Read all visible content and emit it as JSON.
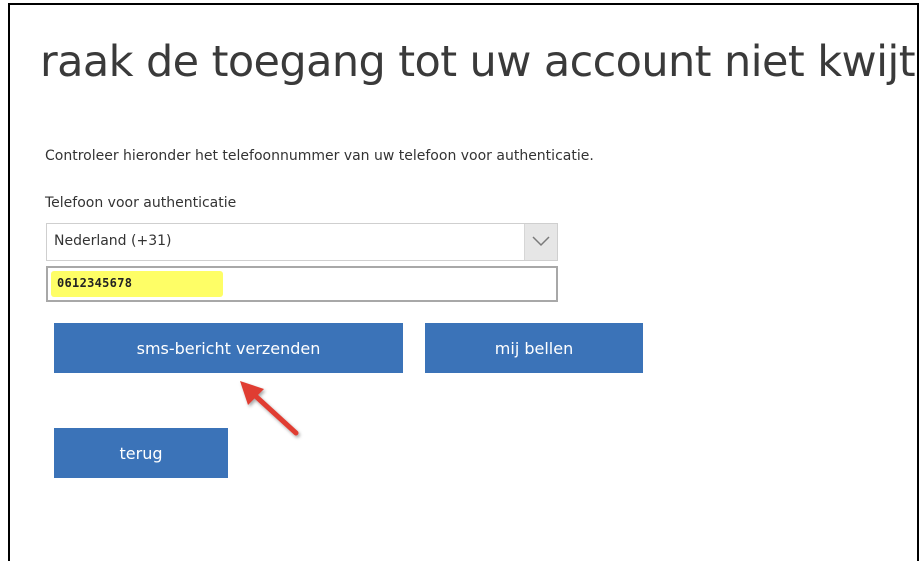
{
  "page": {
    "title": "raak de toegang tot uw account niet kwijt",
    "instruction": "Controleer hieronder het telefoonnummer van uw telefoon voor authenticatie.",
    "phone_label": "Telefoon voor authenticatie"
  },
  "country_select": {
    "value": "Nederland (+31)",
    "icon": "chevron-down-icon"
  },
  "phone_input": {
    "value": "0612345678",
    "highlight_color": "#fefe66"
  },
  "buttons": {
    "sms_label": "sms-bericht verzenden",
    "call_label": "mij bellen",
    "back_label": "terug"
  },
  "annotation": {
    "icon": "red-arrow-icon",
    "color": "#e03c31"
  },
  "colors": {
    "button_background": "#3b73b8",
    "button_text": "#ffffff",
    "title_text": "#3a3a3a"
  }
}
